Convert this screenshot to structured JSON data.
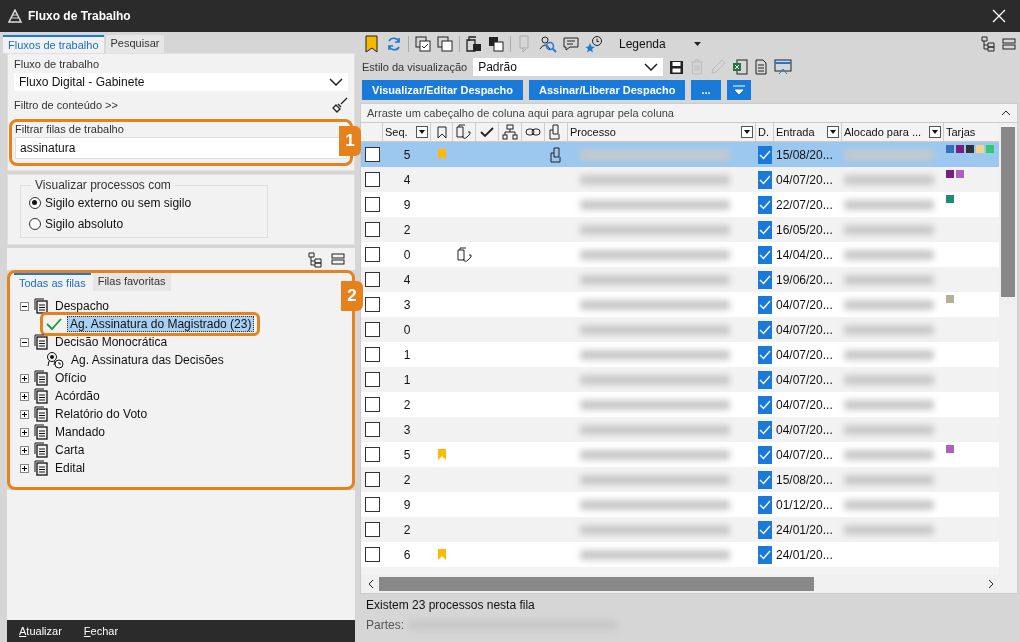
{
  "window": {
    "title": "Fluxo de Trabalho"
  },
  "left": {
    "tabs": [
      {
        "label": "Fluxos de trabalho",
        "selected": true
      },
      {
        "label": "Pesquisar",
        "selected": false
      }
    ],
    "workflow_label": "Fluxo de trabalho",
    "workflow_value": "Fluxo Digital - Gabinete",
    "content_filter": "Filtro de conteúdo >>",
    "queue_filter_label": "Filtrar filas de trabalho",
    "queue_filter_value": "assinatura",
    "visibility": {
      "legend": "Visualizar processos com",
      "options": [
        {
          "label": "Sigilo externo ou sem sigilo",
          "selected": true
        },
        {
          "label": "Sigilo absoluto",
          "selected": false
        }
      ]
    },
    "queue_tabs": [
      {
        "label": "Todas as filas",
        "selected": true
      },
      {
        "label": "Filas favoritas",
        "selected": false
      }
    ],
    "tree": [
      {
        "label": "Despacho",
        "expanded": true,
        "children": [
          {
            "label": "Ag. Assinatura do Magistrado (23)",
            "kind": "check",
            "selected": true
          }
        ]
      },
      {
        "label": "Decisão Monocrática",
        "expanded": true,
        "children": [
          {
            "label": "Ag. Assinatura das Decisões",
            "kind": "seal",
            "selected": false
          }
        ]
      },
      {
        "label": "Ofício",
        "expanded": false
      },
      {
        "label": "Acórdão",
        "expanded": false
      },
      {
        "label": "Relatório do Voto",
        "expanded": false
      },
      {
        "label": "Mandado",
        "expanded": false
      },
      {
        "label": "Carta",
        "expanded": false
      },
      {
        "label": "Edital",
        "expanded": false
      }
    ],
    "footer": [
      "Atualizar",
      "Fechar"
    ]
  },
  "callouts": [
    "1",
    "2"
  ],
  "toolbar": {
    "legend": "Legenda"
  },
  "view_style": {
    "label": "Estilo da visualização",
    "value": "Padrão"
  },
  "actions": [
    "Visualizar/Editar Despacho",
    "Assinar/Liberar Despacho",
    "..."
  ],
  "grid": {
    "group_hint": "Arraste um cabeçalho de coluna aqui para agrupar pela coluna",
    "headers": {
      "seq": "Seq.",
      "processo": "Processo",
      "d": "D.",
      "entrada": "Entrada",
      "alocado": "Alocado para ...",
      "tarjas": "Tarjas"
    },
    "rows": [
      {
        "selected": true,
        "seq": "5",
        "bookmark": true,
        "attachment": false,
        "document": true,
        "checked": true,
        "entrada": "15/08/20...",
        "allocated_shown": true,
        "tarjas": [
          {
            "color": "#3a6fb5"
          },
          {
            "color": "#7b1f7e"
          },
          {
            "color": "#333333"
          },
          {
            "color": "#f5d38a"
          },
          {
            "color": "#2ecc71"
          }
        ]
      },
      {
        "selected": false,
        "seq": "4",
        "bookmark": false,
        "attachment": false,
        "document": false,
        "checked": true,
        "entrada": "04/07/20...",
        "allocated_shown": true,
        "tarjas": [
          {
            "color": "#7b1f7e"
          },
          {
            "color": "#b05fc0"
          }
        ]
      },
      {
        "selected": false,
        "seq": "9",
        "bookmark": false,
        "attachment": false,
        "document": false,
        "checked": true,
        "entrada": "22/07/20...",
        "allocated_shown": true,
        "tarjas": [
          {
            "color": "#1f8a7a"
          }
        ]
      },
      {
        "selected": false,
        "seq": "2",
        "bookmark": false,
        "attachment": false,
        "document": false,
        "checked": true,
        "entrada": "16/05/20...",
        "allocated_shown": true,
        "tarjas": []
      },
      {
        "selected": false,
        "seq": "0",
        "bookmark": false,
        "attachment": true,
        "document": false,
        "checked": true,
        "entrada": "14/04/20...",
        "allocated_shown": true,
        "tarjas": []
      },
      {
        "selected": false,
        "seq": "4",
        "bookmark": false,
        "attachment": false,
        "document": false,
        "checked": true,
        "entrada": "19/06/20...",
        "allocated_shown": true,
        "tarjas": []
      },
      {
        "selected": false,
        "seq": "3",
        "bookmark": false,
        "attachment": false,
        "document": false,
        "checked": true,
        "entrada": "04/07/20...",
        "allocated_shown": true,
        "tarjas": [
          {
            "color": "#b8b096"
          }
        ]
      },
      {
        "selected": false,
        "seq": "0",
        "bookmark": false,
        "attachment": false,
        "document": false,
        "checked": true,
        "entrada": "04/07/20...",
        "allocated_shown": true,
        "tarjas": []
      },
      {
        "selected": false,
        "seq": "1",
        "bookmark": false,
        "attachment": false,
        "document": false,
        "checked": true,
        "entrada": "04/07/20...",
        "allocated_shown": true,
        "tarjas": []
      },
      {
        "selected": false,
        "seq": "1",
        "bookmark": false,
        "attachment": false,
        "document": false,
        "checked": true,
        "entrada": "04/07/20...",
        "allocated_shown": true,
        "tarjas": []
      },
      {
        "selected": false,
        "seq": "2",
        "bookmark": false,
        "attachment": false,
        "document": false,
        "checked": true,
        "entrada": "04/07/20...",
        "allocated_shown": true,
        "tarjas": []
      },
      {
        "selected": false,
        "seq": "3",
        "bookmark": false,
        "attachment": false,
        "document": false,
        "checked": true,
        "entrada": "04/07/20...",
        "allocated_shown": true,
        "tarjas": []
      },
      {
        "selected": false,
        "seq": "5",
        "bookmark": true,
        "attachment": false,
        "document": false,
        "checked": true,
        "entrada": "04/07/20...",
        "allocated_shown": true,
        "tarjas": [
          {
            "color": "#b05fc0"
          }
        ]
      },
      {
        "selected": false,
        "seq": "2",
        "bookmark": false,
        "attachment": false,
        "document": false,
        "checked": true,
        "entrada": "15/08/20...",
        "allocated_shown": true,
        "tarjas": []
      },
      {
        "selected": false,
        "seq": "9",
        "bookmark": false,
        "attachment": false,
        "document": false,
        "checked": true,
        "entrada": "01/12/20...",
        "allocated_shown": true,
        "tarjas": []
      },
      {
        "selected": false,
        "seq": "2",
        "bookmark": false,
        "attachment": false,
        "document": false,
        "checked": true,
        "entrada": "24/01/20...",
        "allocated_shown": true,
        "tarjas": []
      },
      {
        "selected": false,
        "seq": "6",
        "bookmark": true,
        "attachment": false,
        "document": false,
        "checked": true,
        "entrada": "24/01/20...",
        "allocated_shown": false,
        "tarjas": []
      }
    ]
  },
  "status": "Existem 23 processos nesta fila",
  "parties_label": "Partes:"
}
